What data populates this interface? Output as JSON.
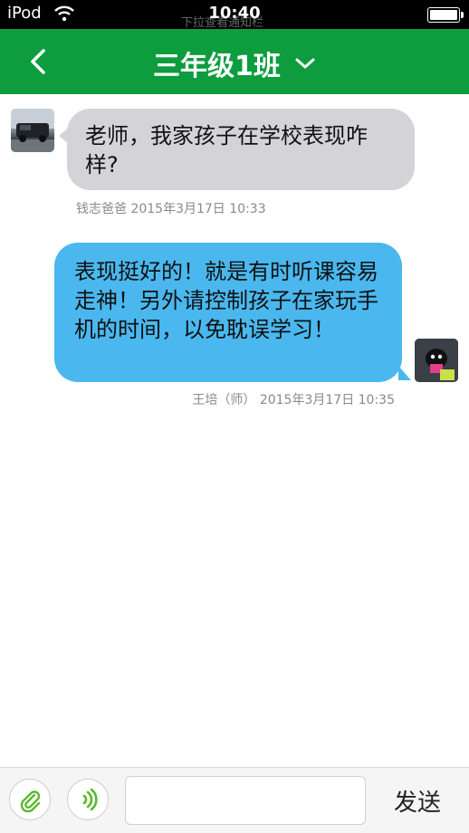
{
  "status_bar": {
    "carrier": "iPod",
    "time": "10:40",
    "ghost_text": "下拉查看通知栏"
  },
  "nav": {
    "title": "三年级1班",
    "back_icon": "chevron-left-icon",
    "dropdown_icon": "chevron-down-icon"
  },
  "messages": [
    {
      "side": "left",
      "text": "老师，我家孩子在学校表现咋样?",
      "sender_time": "钱志爸爸 2015年3月17日 10:33"
    },
    {
      "side": "right",
      "text": "表现挺好的！就是有时听课容易走神！另外请控制孩子在家玩手机的时间，以免耽误学习！",
      "sender_time": "王培（师） 2015年3月17日 10:35"
    }
  ],
  "composer": {
    "input_value": "",
    "send_label": "发送",
    "attach_icon": "paperclip-icon",
    "voice_icon": "voice-icon"
  },
  "colors": {
    "nav_green": "#0d9d3e",
    "incoming_bubble": "#d4d4d8",
    "outgoing_bubble": "#4ab8ef",
    "icon_green": "#59b82c"
  }
}
